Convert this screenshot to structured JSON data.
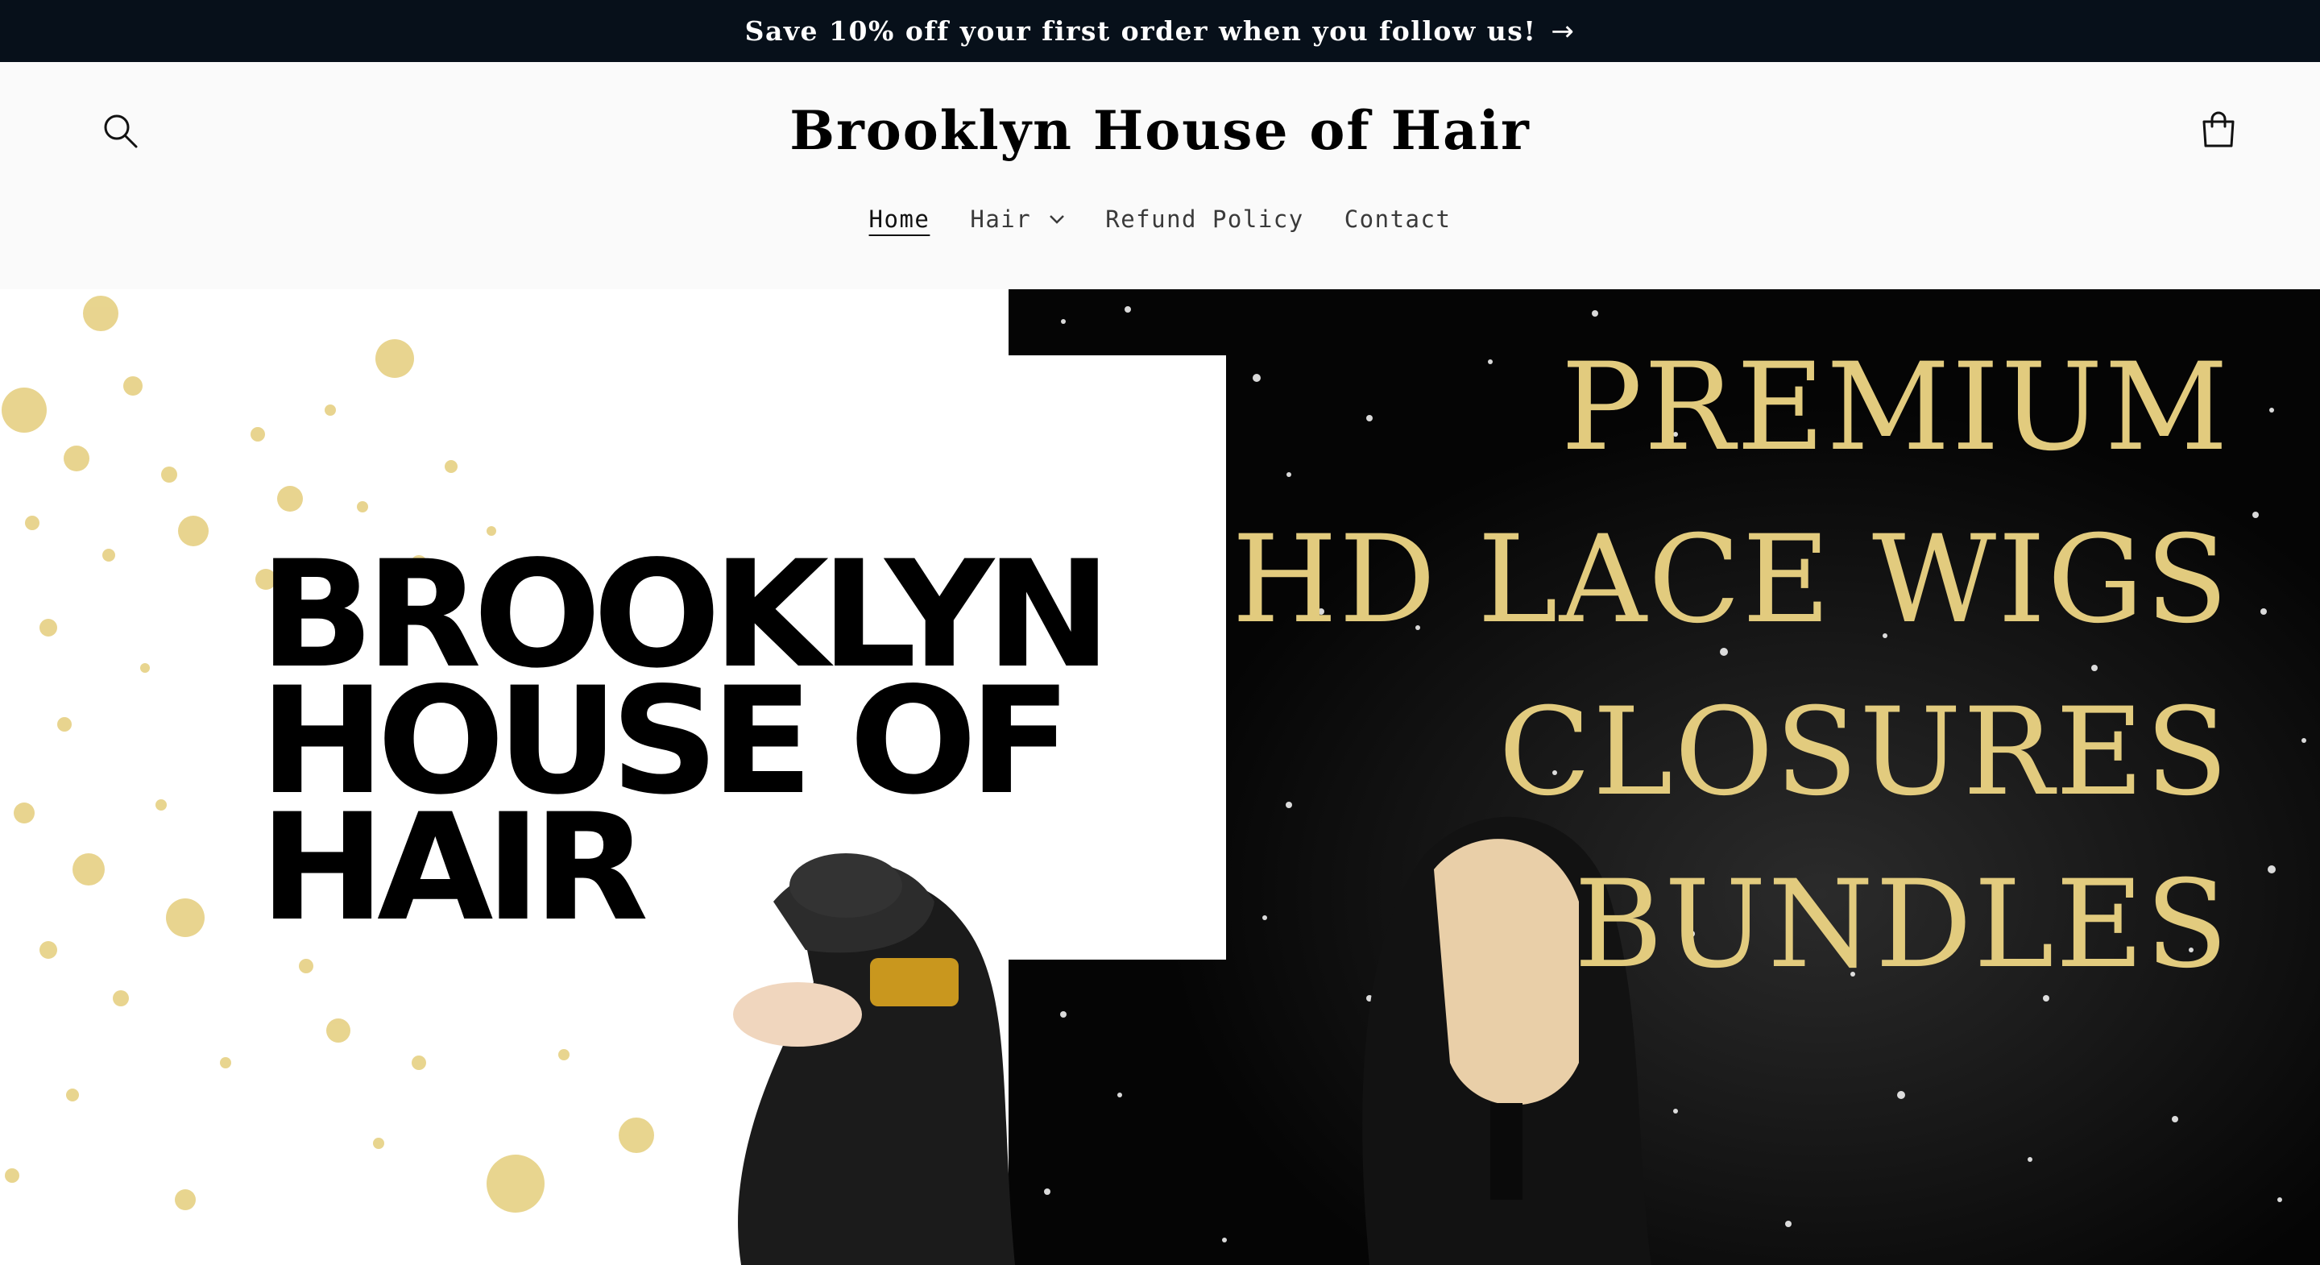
{
  "announcement": {
    "text": "Save 10% off your first order when you follow us!",
    "arrow": "→"
  },
  "header": {
    "logo": "Brooklyn House of Hair",
    "search_icon": "search-icon",
    "cart_icon": "cart-icon"
  },
  "nav": {
    "items": [
      {
        "label": "Home",
        "active": true
      },
      {
        "label": "Hair",
        "has_dropdown": true
      },
      {
        "label": "Refund Policy"
      },
      {
        "label": "Contact"
      }
    ]
  },
  "hero": {
    "left_title": "BROOKLYN\nHOUSE OF\nHAIR",
    "right_lines": [
      "PREMIUM",
      "HD LACE WIGS",
      "CLOSURES",
      "BUNDLES"
    ],
    "colors": {
      "gold": "#e2cb7e",
      "black": "#000000",
      "bar": "#07101a"
    }
  }
}
